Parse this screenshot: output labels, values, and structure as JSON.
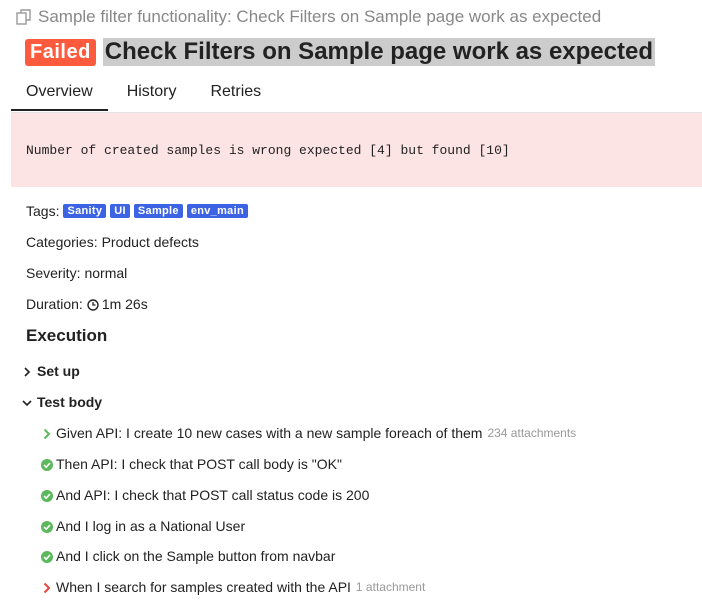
{
  "header": {
    "suite_title": "Sample filter functionality: Check Filters on Sample page work as expected",
    "status": "Failed",
    "test_title": "Check Filters on Sample page work as expected"
  },
  "tabs": [
    {
      "label": "Overview",
      "active": true
    },
    {
      "label": "History",
      "active": false
    },
    {
      "label": "Retries",
      "active": false
    }
  ],
  "error": {
    "message": "Number of created samples is wrong expected [4] but found [10]"
  },
  "meta": {
    "tags_label": "Tags:",
    "tags": [
      "Sanity",
      "UI",
      "Sample",
      "env_main"
    ],
    "categories_label": "Categories:",
    "categories_value": "Product defects",
    "severity_label": "Severity:",
    "severity_value": "normal",
    "duration_label": "Duration:",
    "duration_value": "1m 26s"
  },
  "execution": {
    "title": "Execution",
    "setup_label": "Set up",
    "test_body_label": "Test body",
    "steps": [
      {
        "text": "Given API: I create 10 new cases with a new sample foreach of them",
        "attachments": "234 attachments",
        "status": "expand-green"
      },
      {
        "text": "Then API: I check that POST call body is \"OK\"",
        "attachments": "",
        "status": "passed"
      },
      {
        "text": "And API: I check that POST call status code is 200",
        "attachments": "",
        "status": "passed"
      },
      {
        "text": "And I log in as a National User",
        "attachments": "",
        "status": "passed"
      },
      {
        "text": "And I click on the Sample button from navbar",
        "attachments": "",
        "status": "passed"
      },
      {
        "text": "When I search for samples created with the API",
        "attachments": "1 attachment",
        "status": "expand-red"
      }
    ]
  },
  "colors": {
    "failed": "#fd5a3e",
    "passed": "#5cb85c",
    "tag": "#3b63e3",
    "error_bg": "#fde4e4"
  }
}
